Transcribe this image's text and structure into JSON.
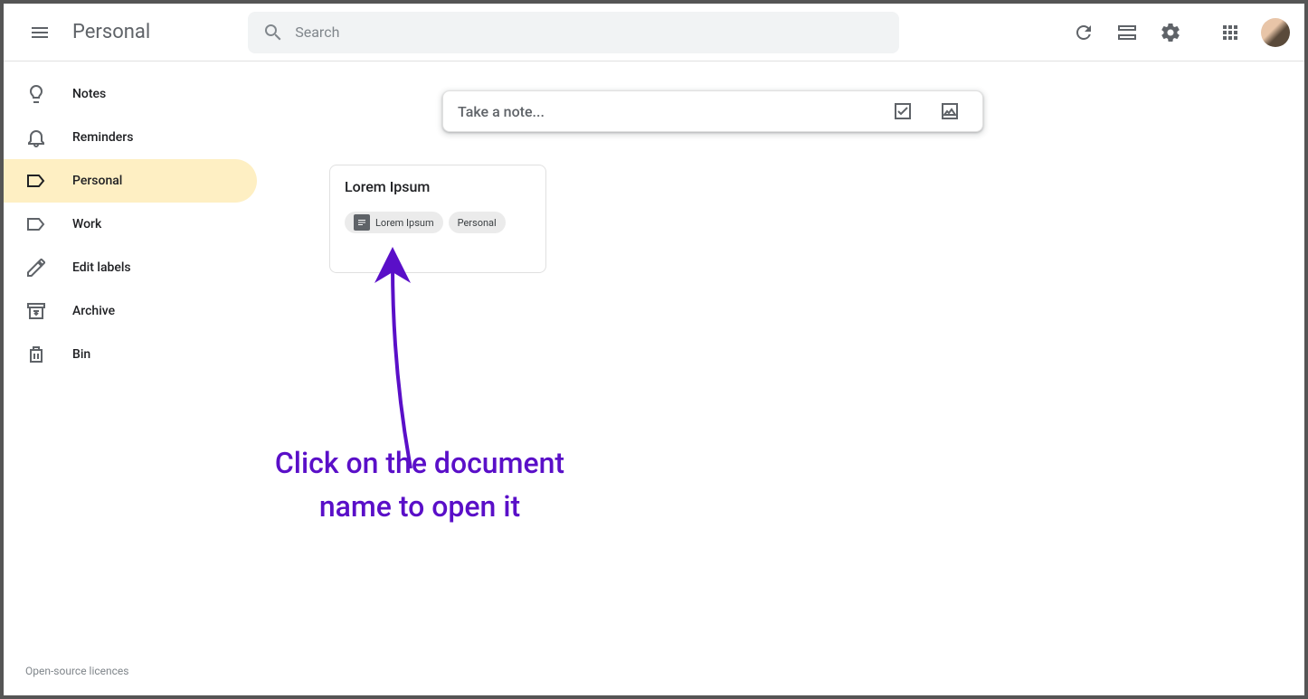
{
  "header": {
    "title": "Personal",
    "search_placeholder": "Search"
  },
  "sidebar": {
    "items": [
      {
        "label": "Notes",
        "id": "notes"
      },
      {
        "label": "Reminders",
        "id": "reminders"
      },
      {
        "label": "Personal",
        "id": "personal"
      },
      {
        "label": "Work",
        "id": "work"
      },
      {
        "label": "Edit labels",
        "id": "edit-labels"
      },
      {
        "label": "Archive",
        "id": "archive"
      },
      {
        "label": "Bin",
        "id": "bin"
      }
    ],
    "footer": "Open-source licences"
  },
  "take_note": {
    "placeholder": "Take a note..."
  },
  "notes": [
    {
      "title": "Lorem Ipsum",
      "chips": [
        {
          "label": "Lorem Ipsum",
          "has_icon": true
        },
        {
          "label": "Personal",
          "has_icon": false
        }
      ]
    }
  ],
  "annotation": {
    "text_line1": "Click on the document",
    "text_line2": "name to open it"
  }
}
